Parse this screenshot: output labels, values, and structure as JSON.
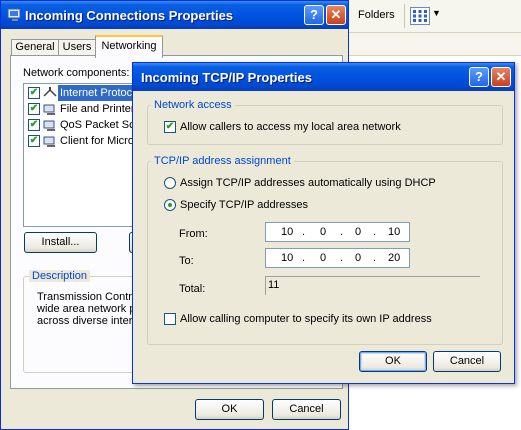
{
  "background": {
    "folders_label": "Folders"
  },
  "back_window": {
    "title": "Incoming Connections Properties",
    "help_btn": "?",
    "close_btn": "✕",
    "tabs": [
      {
        "label": "General"
      },
      {
        "label": "Users"
      },
      {
        "label": "Networking"
      }
    ],
    "components_label": "Network components:",
    "components": [
      {
        "label": "Internet Protoco",
        "checked": true,
        "selected": true
      },
      {
        "label": "File and Printer S",
        "checked": true,
        "selected": false
      },
      {
        "label": "QoS Packet Sch",
        "checked": true,
        "selected": false
      },
      {
        "label": "Client for Microso",
        "checked": true,
        "selected": false
      }
    ],
    "install_btn": "Install...",
    "description_legend": "Description",
    "description_lines": [
      "Transmission Control",
      "wide area network pr",
      "across diverse interco"
    ],
    "ok_btn": "OK",
    "cancel_btn": "Cancel"
  },
  "front_window": {
    "title": "Incoming TCP/IP Properties",
    "help_btn": "?",
    "close_btn": "✕",
    "network_access": {
      "legend": "Network access",
      "allow_label": "Allow callers to access my local area network",
      "allow_checked": true
    },
    "assignment": {
      "legend": "TCP/IP address assignment",
      "dhcp_label": "Assign TCP/IP addresses automatically using DHCP",
      "specify_label": "Specify TCP/IP addresses",
      "selected": "specify",
      "from_label": "From:",
      "from_octets": [
        "10",
        "0",
        "0",
        "10"
      ],
      "to_label": "To:",
      "to_octets": [
        "10",
        "0",
        "0",
        "20"
      ],
      "dot": ".",
      "total_label": "Total:",
      "total_value": "11",
      "allow_own_ip_label": "Allow calling computer to specify its own IP address",
      "allow_own_ip_checked": false
    },
    "ok_btn": "OK",
    "cancel_btn": "Cancel"
  }
}
